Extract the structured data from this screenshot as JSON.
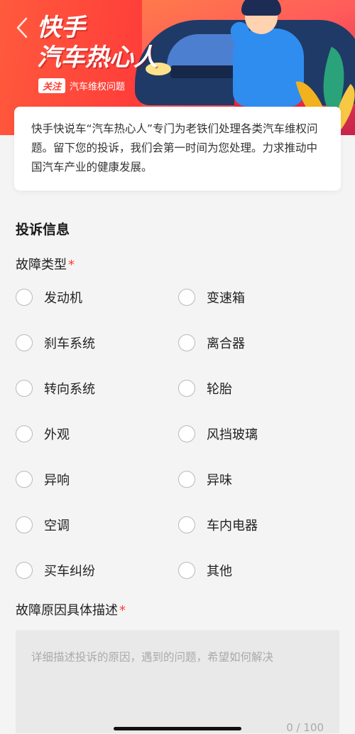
{
  "banner": {
    "title_line1": "快手",
    "title_line2": "汽车热心人",
    "follow_label": "关注",
    "topic": "汽车维权问题"
  },
  "intro": {
    "text": "快手快说车“汽车热心人”专门为老铁们处理各类汽车维权问题。留下您的投诉，我们会第一时间为您处理。力求推动中国汽车产业的健康发展。"
  },
  "form": {
    "section_title": "投诉信息",
    "fault_type": {
      "label": "故障类型",
      "required_mark": "*",
      "options": [
        "发动机",
        "变速箱",
        "刹车系统",
        "离合器",
        "转向系统",
        "轮胎",
        "外观",
        "风挡玻璃",
        "异响",
        "异味",
        "空调",
        "车内电器",
        "买车纠纷",
        "其他"
      ]
    },
    "description": {
      "label": "故障原因具体描述",
      "required_mark": "*",
      "placeholder": "详细描述投诉的原因，遇到的问题，希望如何解决",
      "counter": "0 / 100"
    }
  },
  "colors": {
    "accent": "#ff3b30",
    "banner_red": "#ff3a3a"
  }
}
